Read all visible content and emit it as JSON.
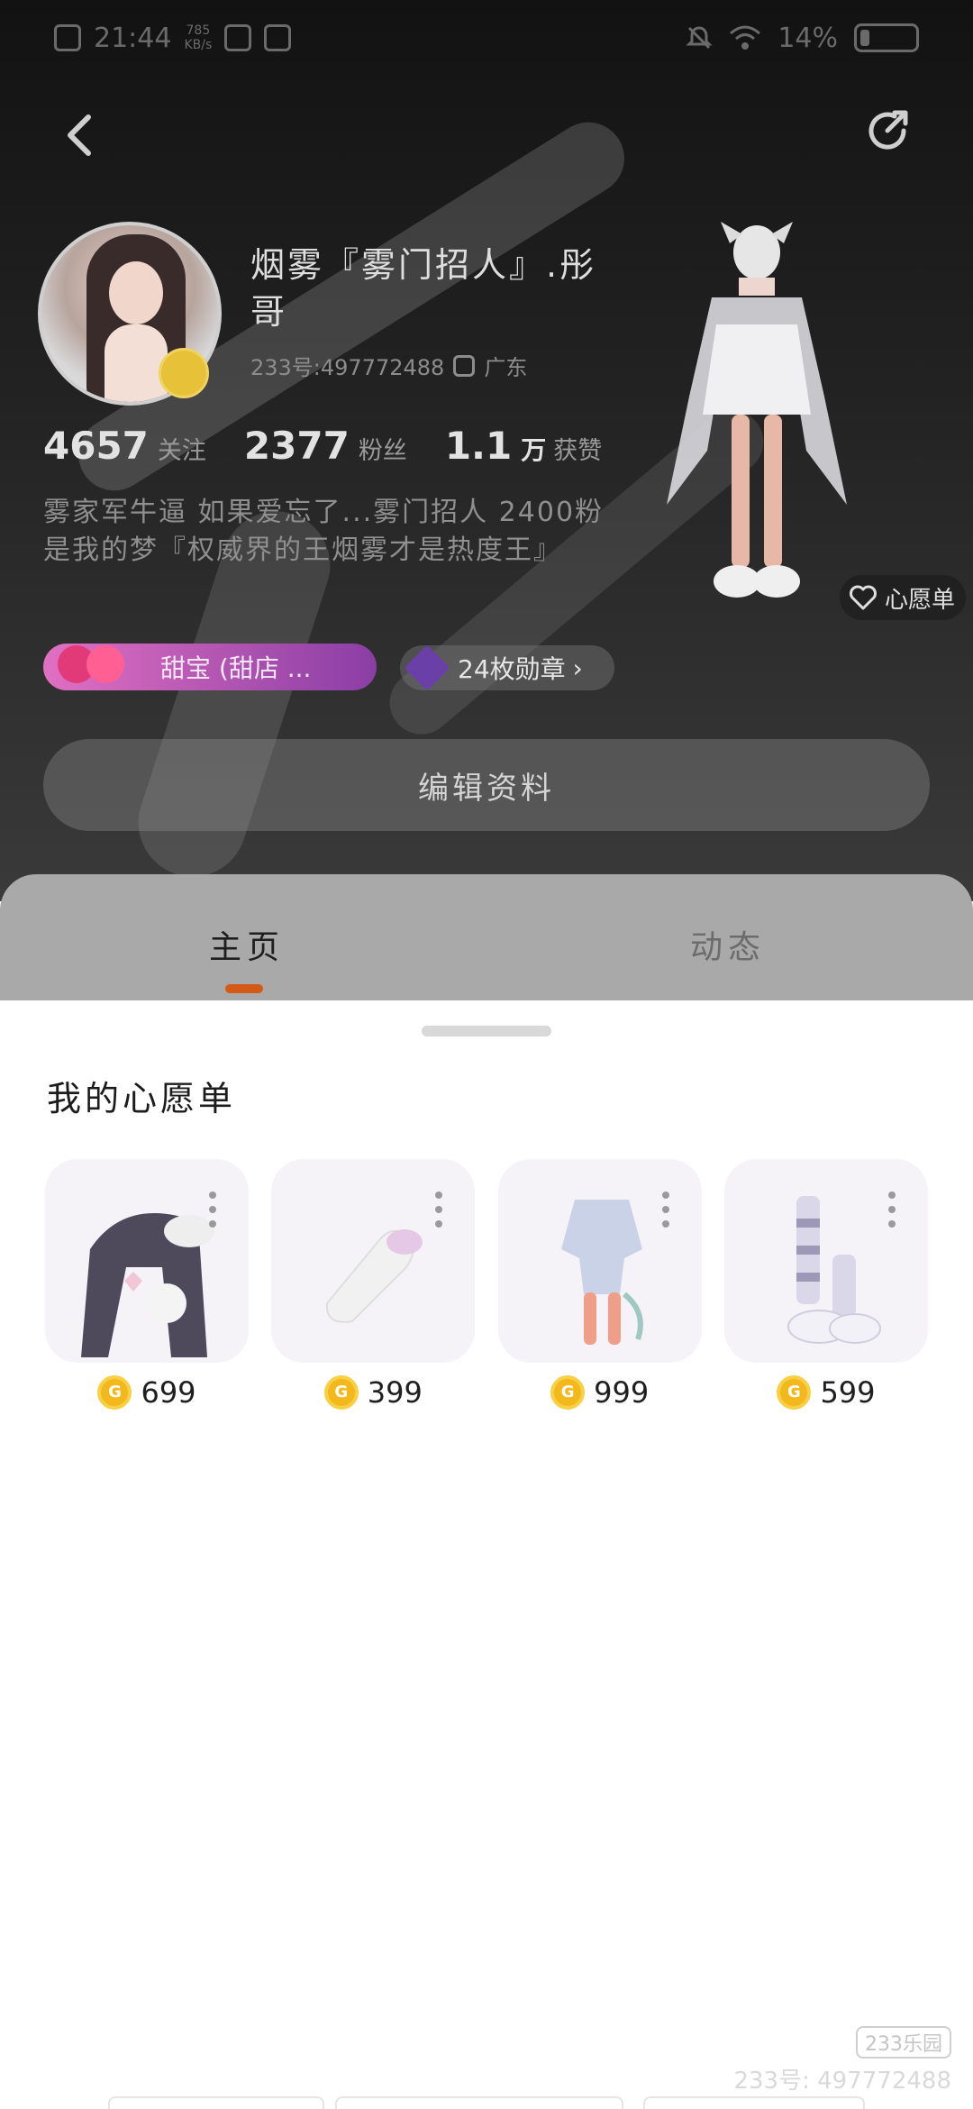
{
  "status_bar": {
    "time": "21:44",
    "net_speed": "785\nKB/s",
    "battery": "14%"
  },
  "profile": {
    "nickname": "烟雾『雾门招人』.彤哥",
    "uid": "233号:497772488",
    "location": "广东",
    "stats": {
      "following": {
        "value": "4657",
        "label": "关注"
      },
      "fans": {
        "value": "2377",
        "label": "粉丝"
      },
      "likes": {
        "value": "1.1",
        "unit": "万",
        "label": "获赞"
      }
    },
    "bio": "雾家军牛逼 如果爱忘了...雾门招人 2400粉是我的梦『权威界的王烟雾才是热度王』",
    "badge_label": "甜宝 (甜店 ...",
    "medals_label": "24枚勋章",
    "wishlist_chip": "心愿单",
    "edit_button": "编辑资料"
  },
  "tabs": [
    {
      "label": "主页",
      "active": true
    },
    {
      "label": "动态",
      "active": false
    }
  ],
  "wishlist": {
    "title": "我的心愿单",
    "items": [
      {
        "icon": "hair-accessory-icon",
        "price": "699"
      },
      {
        "icon": "fluffy-tail-icon",
        "price": "399"
      },
      {
        "icon": "outfit-icon",
        "price": "999"
      },
      {
        "icon": "boots-icon",
        "price": "599"
      }
    ]
  },
  "watermark": {
    "logo": "233乐园",
    "id": "233号: 497772488"
  },
  "colors": {
    "accent": "#d35a16",
    "coin": "#f3b81b",
    "badge_gradient_start": "#e070c2",
    "badge_gradient_end": "#8a3ea4"
  }
}
